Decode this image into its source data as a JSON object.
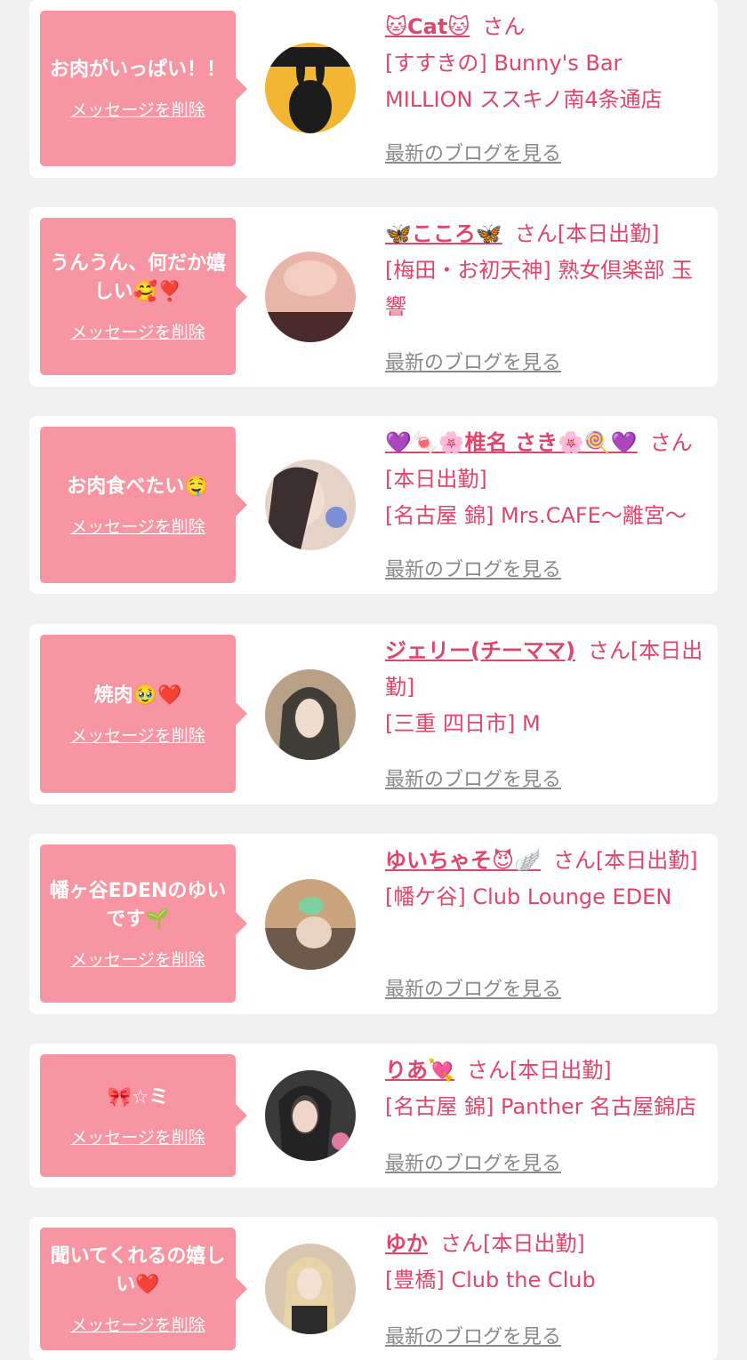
{
  "labels": {
    "delete": "メッセージを削除",
    "blog": "最新のブログを見る"
  },
  "entries": [
    {
      "message": "お肉がいっぱい！！",
      "name": "🐱Cat🐱",
      "suffix": "さん",
      "shop": "[すすきの] Bunny's Bar MILLION ススキノ南4条通店",
      "avatar_colors": [
        "#f2b632",
        "#1c1c1c"
      ]
    },
    {
      "message": "うんうん、何だか嬉しい🥰❣️",
      "name": "🦋こころ🦋",
      "suffix": "さん[本日出勤]",
      "shop": "[梅田・お初天神] 熟女倶楽部 玉響",
      "avatar_colors": [
        "#e9b5a8",
        "#4a2a2a"
      ]
    },
    {
      "message": "お肉食べたい🤤",
      "name": "💜🍬🌸椎名 さき🌸🍭💜",
      "suffix": "さん[本日出勤]",
      "shop": "[名古屋 錦] Mrs.CAFE～離宮～",
      "avatar_colors": [
        "#e6d3c8",
        "#3b2f2f"
      ]
    },
    {
      "message": "焼肉🥹❤️",
      "name": "ジェリー(チーママ)",
      "suffix": "さん[本日出勤]",
      "shop": "[三重 四日市] M",
      "avatar_colors": [
        "#b8a187",
        "#2a2a2a"
      ]
    },
    {
      "message": "幡ヶ谷EDENのゆいです🌱",
      "name": "ゆいちゃそ😈🪽",
      "suffix": "さん[本日出勤]",
      "shop": "[幡ケ谷] Club Lounge EDEN",
      "avatar_colors": [
        "#c9a47c",
        "#6d5a4a"
      ]
    },
    {
      "message": "🎀☆ミ",
      "name": "りあ💘",
      "suffix": "さん[本日出勤]",
      "shop": "[名古屋 錦] Panther 名古屋錦店",
      "avatar_colors": [
        "#3a3a3a",
        "#e07aa0"
      ]
    },
    {
      "message": "聞いてくれるの嬉しい❤️",
      "name": "ゆか",
      "suffix": "さん[本日出勤]",
      "shop": "[豊橋] Club the Club",
      "avatar_colors": [
        "#d9c6b0",
        "#2b2b2b"
      ]
    }
  ]
}
